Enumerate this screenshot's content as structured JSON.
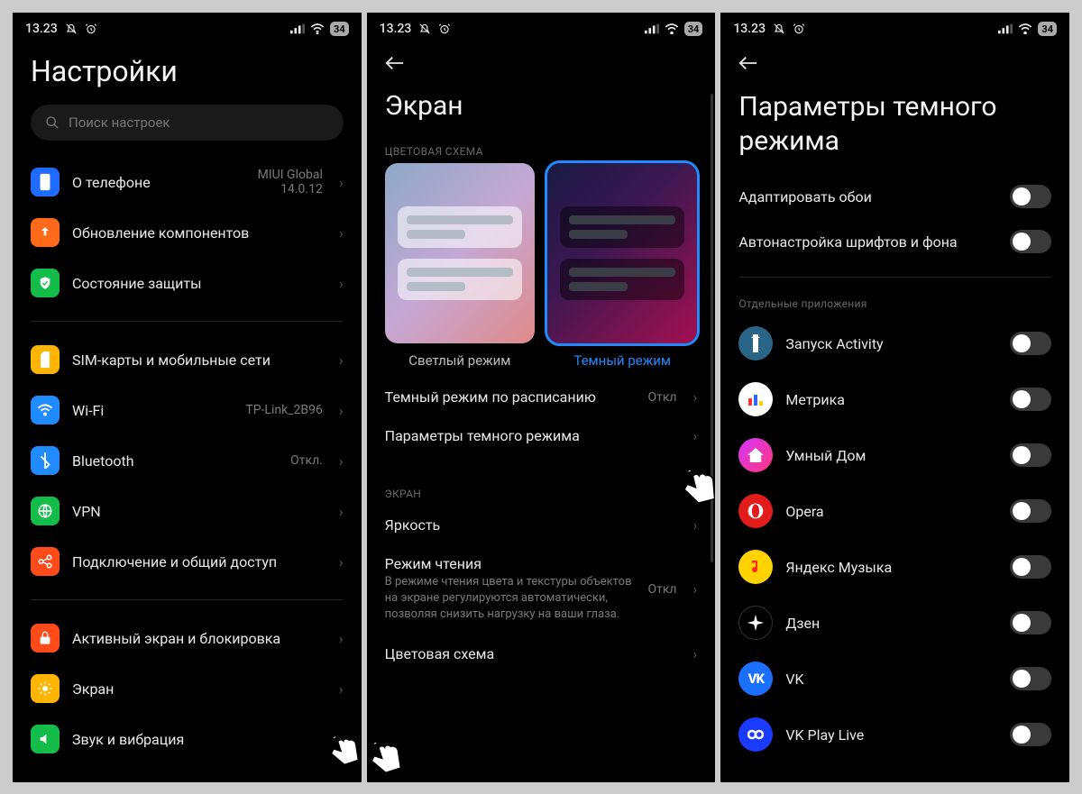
{
  "status": {
    "time": "13.23",
    "battery": "34"
  },
  "screen1": {
    "title": "Настройки",
    "search_placeholder": "Поиск настроек",
    "group1": [
      {
        "id": "about",
        "label": "О телефоне",
        "value1": "MIUI Global",
        "value2": "14.0.12",
        "bg": "#1f6bff"
      },
      {
        "id": "update",
        "label": "Обновление компонентов",
        "bg": "#ff6a1a"
      },
      {
        "id": "security",
        "label": "Состояние защиты",
        "bg": "#14bd4a"
      }
    ],
    "group2": [
      {
        "id": "sim",
        "label": "SIM-карты и мобильные сети",
        "bg": "#ffb400"
      },
      {
        "id": "wifi",
        "label": "Wi-Fi",
        "value": "TP-Link_2B96",
        "bg": "#1f8bff"
      },
      {
        "id": "bt",
        "label": "Bluetooth",
        "value": "Откл.",
        "bg": "#1f8bff"
      },
      {
        "id": "vpn",
        "label": "VPN",
        "bg": "#14bd4a"
      },
      {
        "id": "share",
        "label": "Подключение и общий доступ",
        "bg": "#ff4a1a"
      }
    ],
    "group3": [
      {
        "id": "lock",
        "label": "Активный экран и блокировка",
        "bg": "#ff4a1a"
      },
      {
        "id": "display",
        "label": "Экран",
        "bg": "#ffb400"
      },
      {
        "id": "sound",
        "label": "Звук и вибрация",
        "bg": "#14bd4a"
      }
    ]
  },
  "screen2": {
    "title": "Экран",
    "section_color": "ЦВЕТОВАЯ СХЕМА",
    "light_label": "Светлый режим",
    "dark_label": "Темный режим",
    "rows1": [
      {
        "id": "schedule",
        "label": "Темный режим по расписанию",
        "value": "Откл"
      },
      {
        "id": "dark_params",
        "label": "Параметры темного режима"
      }
    ],
    "section_screen": "ЭКРАН",
    "rows2": [
      {
        "id": "brightness",
        "label": "Яркость"
      },
      {
        "id": "reading",
        "label": "Режим чтения",
        "sub": "В режиме чтения цвета и текстуры объектов на экране регулируются автоматически, позволяя снизить нагрузку на ваши глаза.",
        "value": "Откл"
      },
      {
        "id": "color_scheme",
        "label": "Цветовая схема"
      }
    ]
  },
  "screen3": {
    "title": "Параметры темного режима",
    "top_toggles": [
      {
        "id": "adapt_wp",
        "label": "Адаптировать обои"
      },
      {
        "id": "auto_font",
        "label": "Автонастройка шрифтов и фона"
      }
    ],
    "section_apps": "Отдельные приложения",
    "apps": [
      {
        "id": "activity",
        "label": "Запуск Activity",
        "bg": "#2a6587"
      },
      {
        "id": "metrica",
        "label": "Метрика",
        "bg": "#ffffff"
      },
      {
        "id": "smart",
        "label": "Умный Дом",
        "bg": "linear-gradient(135deg,#d436ff,#ff367a)"
      },
      {
        "id": "opera",
        "label": "Opera",
        "bg": "#e21b1b"
      },
      {
        "id": "ymusic",
        "label": "Яндекс Музыка",
        "bg": "#ffd200"
      },
      {
        "id": "dzen",
        "label": "Дзен",
        "bg": "#000"
      },
      {
        "id": "vk",
        "label": "VK",
        "bg": "#1a6fff"
      },
      {
        "id": "vkplay",
        "label": "VK Play Live",
        "bg": "#1a3aff"
      }
    ]
  }
}
